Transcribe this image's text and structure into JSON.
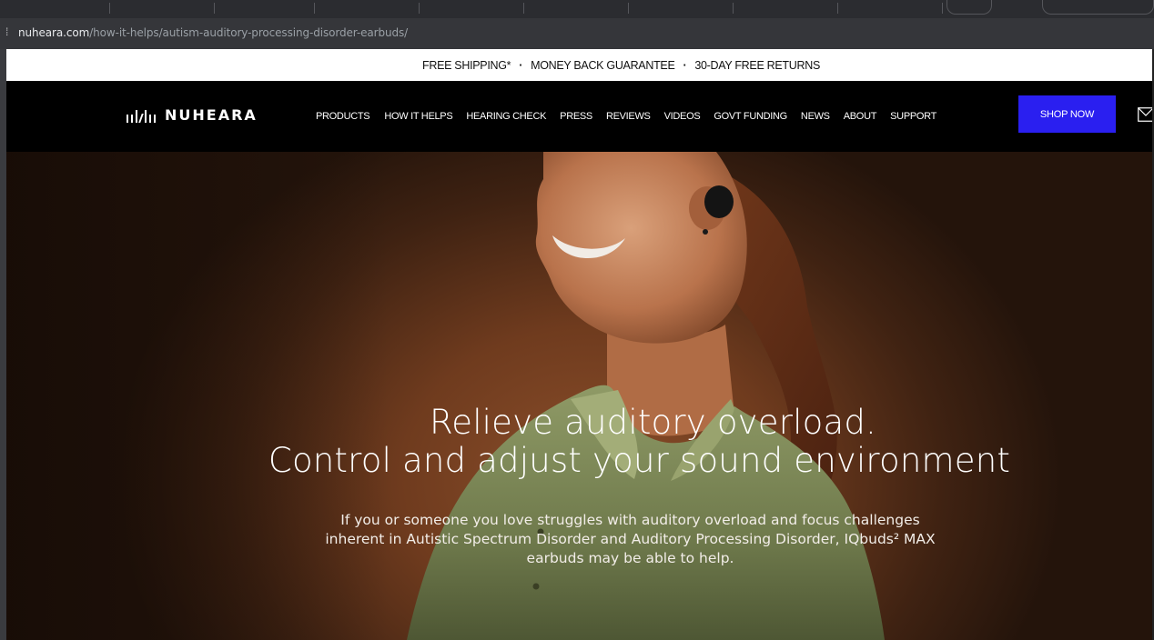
{
  "browser": {
    "url_host": "nuheara.com",
    "url_path": "/how-it-helps/autism-auditory-processing-disorder-earbuds/"
  },
  "promo_bar": {
    "item1": "FREE SHIPPING*",
    "item2": "MONEY BACK GUARANTEE",
    "item3": "30-DAY FREE RETURNS",
    "separator": "·"
  },
  "nav": {
    "logo_text": "NUHEARA",
    "items": [
      "PRODUCTS",
      "HOW IT HELPS",
      "HEARING CHECK",
      "PRESS",
      "REVIEWS",
      "VIDEOS",
      "GOVT FUNDING",
      "NEWS",
      "ABOUT",
      "SUPPORT"
    ],
    "cta_label": "SHOP NOW",
    "icons": [
      "mail-icon"
    ]
  },
  "hero": {
    "title_line1": "Relieve auditory overload.",
    "title_line2": "Control and adjust your sound environment",
    "subtitle": "If you or someone you love struggles with auditory overload and focus challenges inherent in Autistic Spectrum Disorder and Auditory Processing Disorder, IQbuds² MAX earbuds may be able to help."
  },
  "colors": {
    "cta": "#2a1ff0",
    "nav_bg": "#000000",
    "hero_bg": "#6f3b1e"
  }
}
